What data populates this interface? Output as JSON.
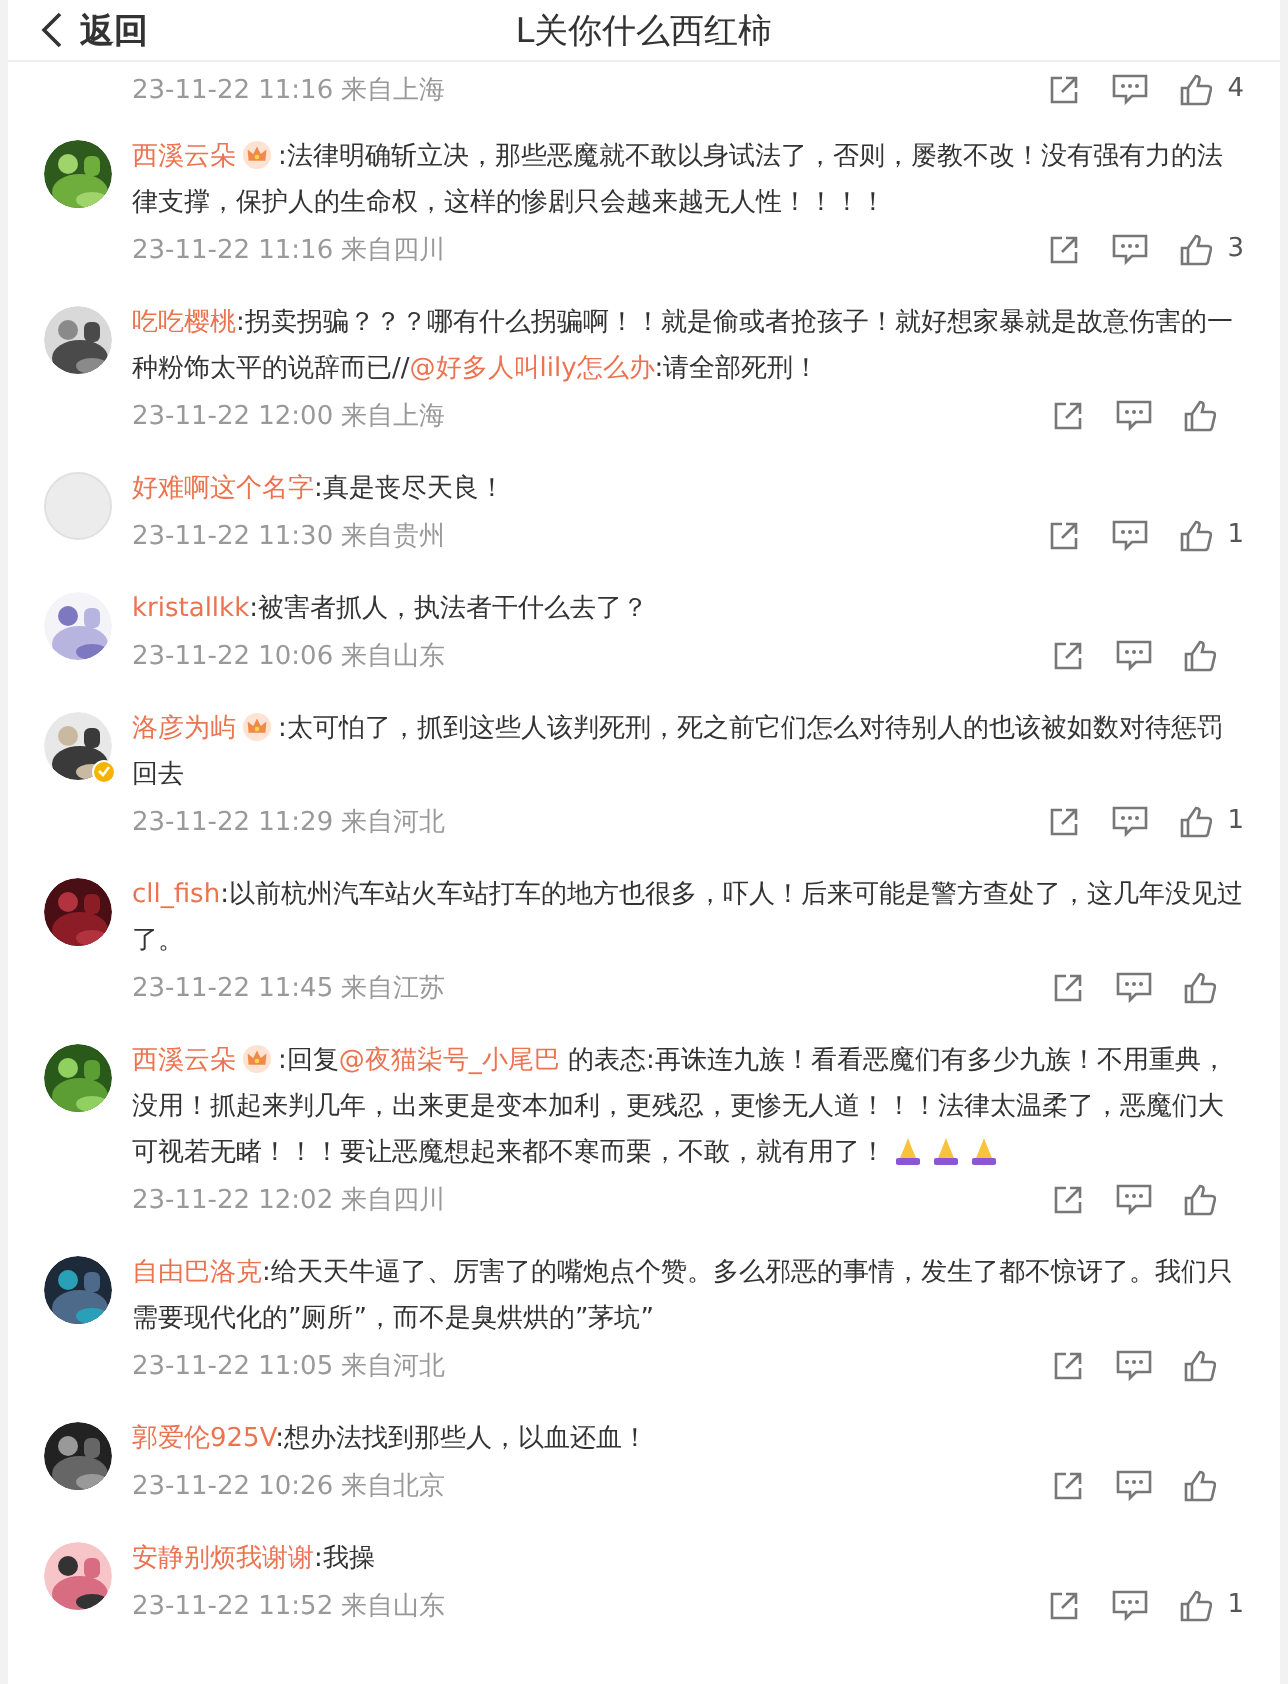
{
  "header": {
    "back_label": "返回",
    "title": "L关你什么西红柿"
  },
  "partial_comment": {
    "time": "23-11-22 11:16",
    "location": "来自上海",
    "likes": "4"
  },
  "comments": [
    {
      "user": "西溪云朵",
      "badge": true,
      "verified": false,
      "segments": [
        {
          "kind": "plain",
          "text": ":法律明确斩立决，那些恶魔就不敢以身试法了，否则，屡教不改！没有强有力的法律支撑，保护人的生命权，这样的惨剧只会越来越无人性！！！！"
        }
      ],
      "time": "23-11-22 11:16",
      "location": "来自四川",
      "likes": "3"
    },
    {
      "user": "吃吃樱桃",
      "badge": false,
      "verified": false,
      "segments": [
        {
          "kind": "plain",
          "text": ":拐卖拐骗？？？哪有什么拐骗啊！！就是偷或者抢孩子！就好想家暴就是故意伤害的一种粉饰太平的说辞而已//"
        },
        {
          "kind": "mention",
          "text": "@好多人叫lily怎么办"
        },
        {
          "kind": "plain",
          "text": ":请全部死刑！"
        }
      ],
      "time": "23-11-22 12:00",
      "location": "来自上海"
    },
    {
      "avatar": {
        "kind": "default"
      },
      "user": "好难啊这个名字",
      "badge": false,
      "verified": false,
      "segments": [
        {
          "kind": "plain",
          "text": ":真是丧尽天良！"
        }
      ],
      "time": "23-11-22 11:30",
      "location": "来自贵州",
      "likes": "1"
    },
    {
      "user": "kristallkk",
      "badge": false,
      "verified": false,
      "segments": [
        {
          "kind": "plain",
          "text": ":被害者抓人，执法者干什么去了？"
        }
      ],
      "time": "23-11-22 10:06",
      "location": "来自山东"
    },
    {
      "user": "洛彦为屿",
      "badge": true,
      "verified": true,
      "segments": [
        {
          "kind": "plain",
          "text": ":太可怕了，抓到这些人该判死刑，死之前它们怎么对待别人的也该被如数对待惩罚回去"
        }
      ],
      "time": "23-11-22 11:29",
      "location": "来自河北",
      "likes": "1"
    },
    {
      "user": "cll_fish",
      "badge": false,
      "verified": false,
      "segments": [
        {
          "kind": "plain",
          "text": ":以前杭州汽车站火车站打车的地方也很多，吓人！后来可能是警方查处了，这几年没见过了。"
        }
      ],
      "time": "23-11-22 11:45",
      "location": "来自江苏"
    },
    {
      "user": "西溪云朵",
      "badge": true,
      "verified": false,
      "segments": [
        {
          "kind": "plain",
          "text": ":回复"
        },
        {
          "kind": "mention",
          "text": "@夜猫柒号_小尾巴"
        },
        {
          "kind": "plain",
          "text": " 的表态:再诛连九族！看看恶魔们有多少九族！不用重典，没用！抓起来判几年，出来更是变本加利，更残忍，更惨无人道！！！法律太温柔了，恶魔们大可视若无睹！！！要让恶魔想起来都不寒而栗，不敢，就有用了！"
        },
        {
          "kind": "emoji"
        },
        {
          "kind": "emoji"
        },
        {
          "kind": "emoji"
        }
      ],
      "time": "23-11-22 12:02",
      "location": "来自四川"
    },
    {
      "user": "自由巴洛克",
      "badge": false,
      "verified": false,
      "segments": [
        {
          "kind": "plain",
          "text": ":给天天牛逼了、厉害了的嘴炮点个赞。多么邪恶的事情，发生了都不惊讶了。我们只需要现代化的”厕所”，而不是臭烘烘的”茅坑”"
        }
      ],
      "time": "23-11-22 11:05",
      "location": "来自河北"
    },
    {
      "user": "郭爱伦925V",
      "badge": false,
      "verified": false,
      "segments": [
        {
          "kind": "plain",
          "text": ":想办法找到那些人，以血还血！"
        }
      ],
      "time": "23-11-22 10:26",
      "location": "来自北京"
    },
    {
      "user": "安静别烦我谢谢",
      "badge": false,
      "verified": false,
      "segments": [
        {
          "kind": "plain",
          "text": ":我操"
        }
      ],
      "time": "23-11-22 11:52",
      "location": "来自山东",
      "likes": "1"
    }
  ]
}
